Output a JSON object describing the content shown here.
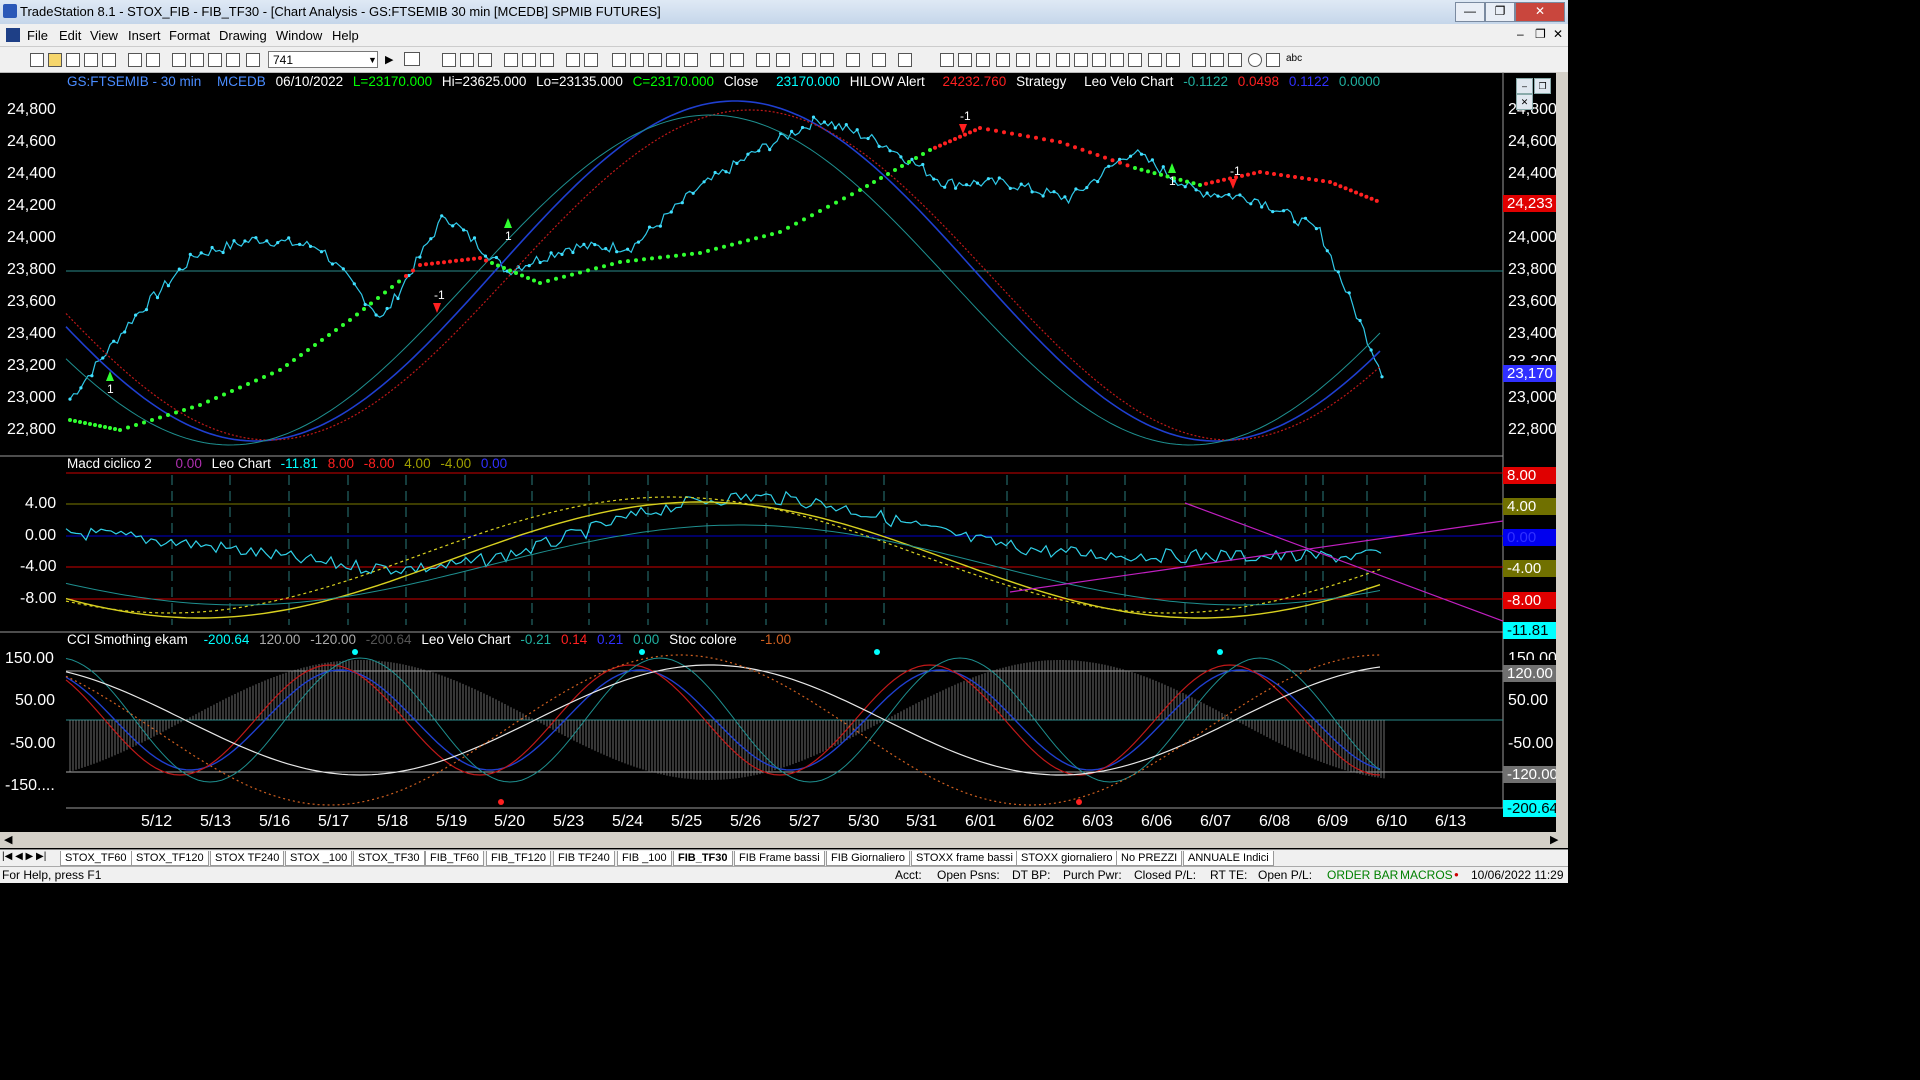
{
  "window": {
    "title": "TradeStation 8.1 - STOX_FIB - FIB_TF30 - [Chart Analysis - GS:FTSEMIB  30 min  [MCEDB] SPMIB FUTURES]",
    "min": "—",
    "max": "❐",
    "close": "✕"
  },
  "menu": [
    "File",
    "Edit",
    "View",
    "Insert",
    "Format",
    "Drawing",
    "Window",
    "Help"
  ],
  "toolbar": {
    "symbol_value": "741"
  },
  "price_header": {
    "symbol": "GS:FTSEMIB - 30 min",
    "feed": "MCEDB",
    "date": "06/10/2022",
    "last": "L=23170.000",
    "high": "Hi=23625.000",
    "low": "Lo=23135.000",
    "close_eq": "C=23170.000",
    "close_label": "Close",
    "close_val": "23170.000",
    "hilow_label": "HILOW Alert",
    "hilow_val": "24232.760",
    "strategy_label": "Strategy",
    "leo_label": "Leo Velo Chart",
    "leo_v1": "-0.1122",
    "leo_v2": "0.0498",
    "leo_v3": "0.1122",
    "leo_v4": "0.0000"
  },
  "macd_header": {
    "name": "Macd ciclico 2",
    "v0": "0.00",
    "leo": "Leo Chart",
    "v1": "-11.81",
    "v2": "8.00",
    "v3": "-8.00",
    "v4": "4.00",
    "v5": "-4.00",
    "v6": "0.00"
  },
  "cci_header": {
    "name": "CCI Smothing ekam",
    "v1": "-200.64",
    "v2": "120.00",
    "v3": "-120.00",
    "v4": "-200.64",
    "leo": "Leo Velo Chart",
    "l1": "-0.21",
    "l2": "0.14",
    "l3": "0.21",
    "l4": "0.00",
    "stoc": "Stoc colore",
    "s1": "-1.00"
  },
  "price_axis": [
    "24,800",
    "24,600",
    "24,400",
    "24,200",
    "24,000",
    "23,800",
    "23,600",
    "23,400",
    "23,200",
    "23,000",
    "22,800"
  ],
  "price_tags": {
    "hilow": "24,233",
    "last": "23,170",
    "hidden": "23,200"
  },
  "macd_axis": [
    "4.00",
    "0.00",
    "-4.00",
    "-8.00"
  ],
  "macd_tags": [
    "8.00",
    "4.00",
    "0.00",
    "-4.00",
    "-8.00",
    "-11.81"
  ],
  "cci_axis": [
    "150.00",
    "50.00",
    "-50.00",
    "-150...."
  ],
  "cci_tags": [
    "150.00",
    "120.00",
    "50.00",
    "-50.00",
    "-120.00",
    "-200.64"
  ],
  "dates": [
    "5/12",
    "5/13",
    "5/16",
    "5/17",
    "5/18",
    "5/19",
    "5/20",
    "5/23",
    "5/24",
    "5/25",
    "5/26",
    "5/27",
    "5/30",
    "5/31",
    "6/01",
    "6/02",
    "6/03",
    "6/06",
    "6/07",
    "6/08",
    "6/09",
    "6/10",
    "6/13"
  ],
  "signals": {
    "buy": "1",
    "sell": "-1"
  },
  "tabs": [
    "STOX_TF60",
    "STOX_TF120",
    "STOX TF240",
    "STOX _100",
    "STOX_TF30",
    "FIB_TF60",
    "FIB_TF120",
    "FIB TF240",
    "FIB _100",
    "FIB_TF30",
    "FIB Frame bassi",
    "FIB Giornaliero",
    "STOXX frame bassi",
    "STOXX giornaliero",
    "No PREZZI",
    "ANNUALE Indici"
  ],
  "active_tab": "FIB_TF30",
  "status": {
    "help": "For Help, press F1",
    "acct": "Acct:",
    "open_psns": "Open Psns:",
    "dt_bp": "DT BP:",
    "purch_pwr": "Purch Pwr:",
    "closed_pl": "Closed P/L:",
    "rt_te": "RT TE:",
    "open_pl": "Open P/L:",
    "order_bar": "ORDER BAR",
    "macros": "MACROS",
    "datetime": "10/06/2022 11:29"
  },
  "chart_data": {
    "type": "line",
    "title": "GS:FTSEMIB - 30 min",
    "x": [
      "5/12",
      "5/13",
      "5/16",
      "5/17",
      "5/18",
      "5/19",
      "5/20",
      "5/23",
      "5/24",
      "5/25",
      "5/26",
      "5/27",
      "5/30",
      "5/31",
      "6/01",
      "6/02",
      "6/03",
      "6/06",
      "6/07",
      "6/08",
      "6/09",
      "6/10"
    ],
    "series": [
      {
        "values": [
          23000,
          23500,
          23900,
          24000,
          23950,
          23500,
          24150,
          23800,
          23950,
          23950,
          24300,
          24550,
          24750,
          24600,
          24350,
          24350,
          24250,
          24550,
          24300,
          24250,
          24050,
          23170
        ]
      }
    ],
    "ylim": [
      22700,
      24900
    ]
  }
}
